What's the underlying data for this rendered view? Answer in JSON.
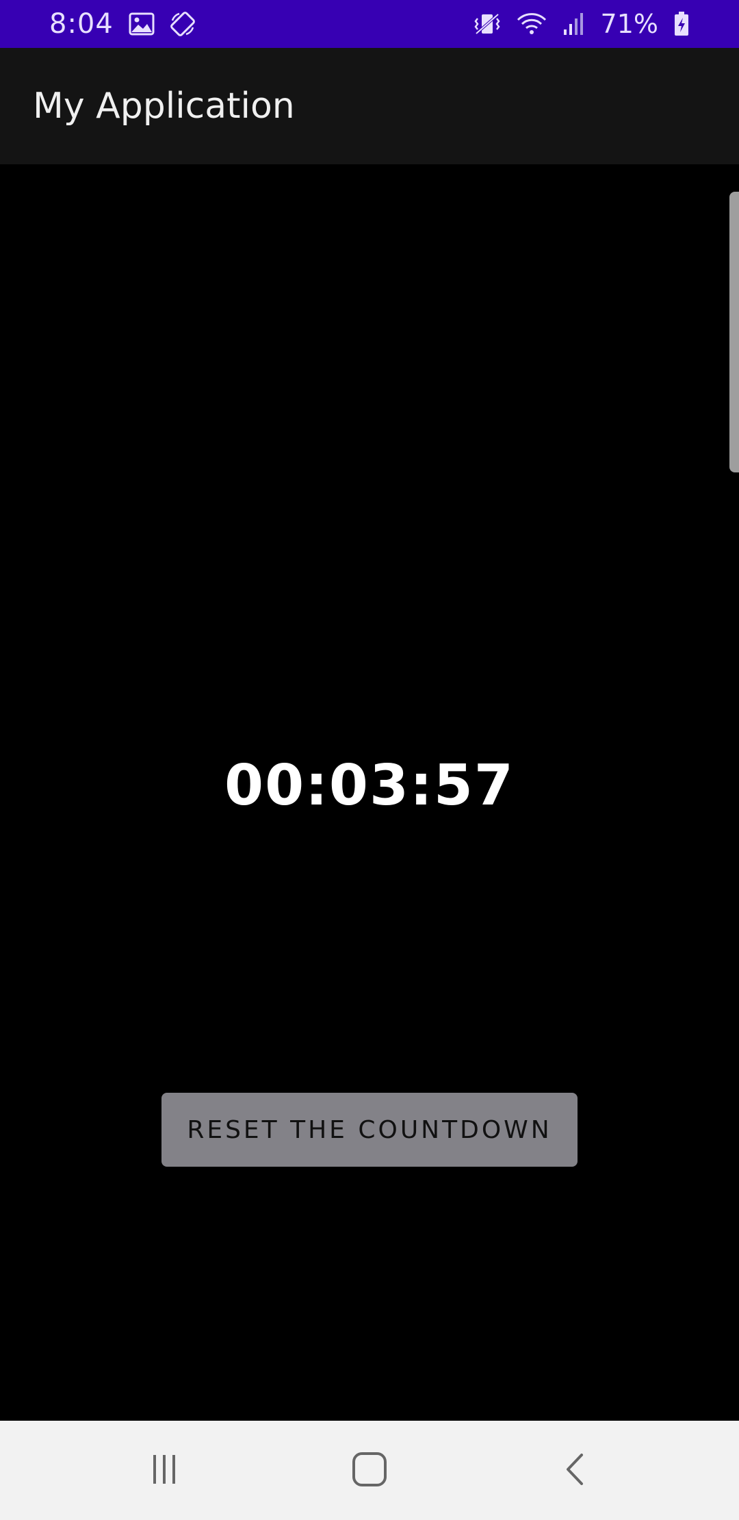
{
  "status_bar": {
    "time": "8:04",
    "battery_percent": "71%",
    "icons": [
      "image-icon",
      "screen-rotation-icon",
      "vibrate-icon",
      "wifi-icon",
      "signal-icon",
      "battery-charging-icon"
    ],
    "background_color": "#3700b3"
  },
  "app_bar": {
    "title": "My Application"
  },
  "main": {
    "timer": "00:03:57",
    "reset_button_label": "RESET THE COUNTDOWN"
  },
  "nav_bar": {
    "buttons": [
      "recent-apps-icon",
      "home-icon",
      "back-icon"
    ]
  }
}
